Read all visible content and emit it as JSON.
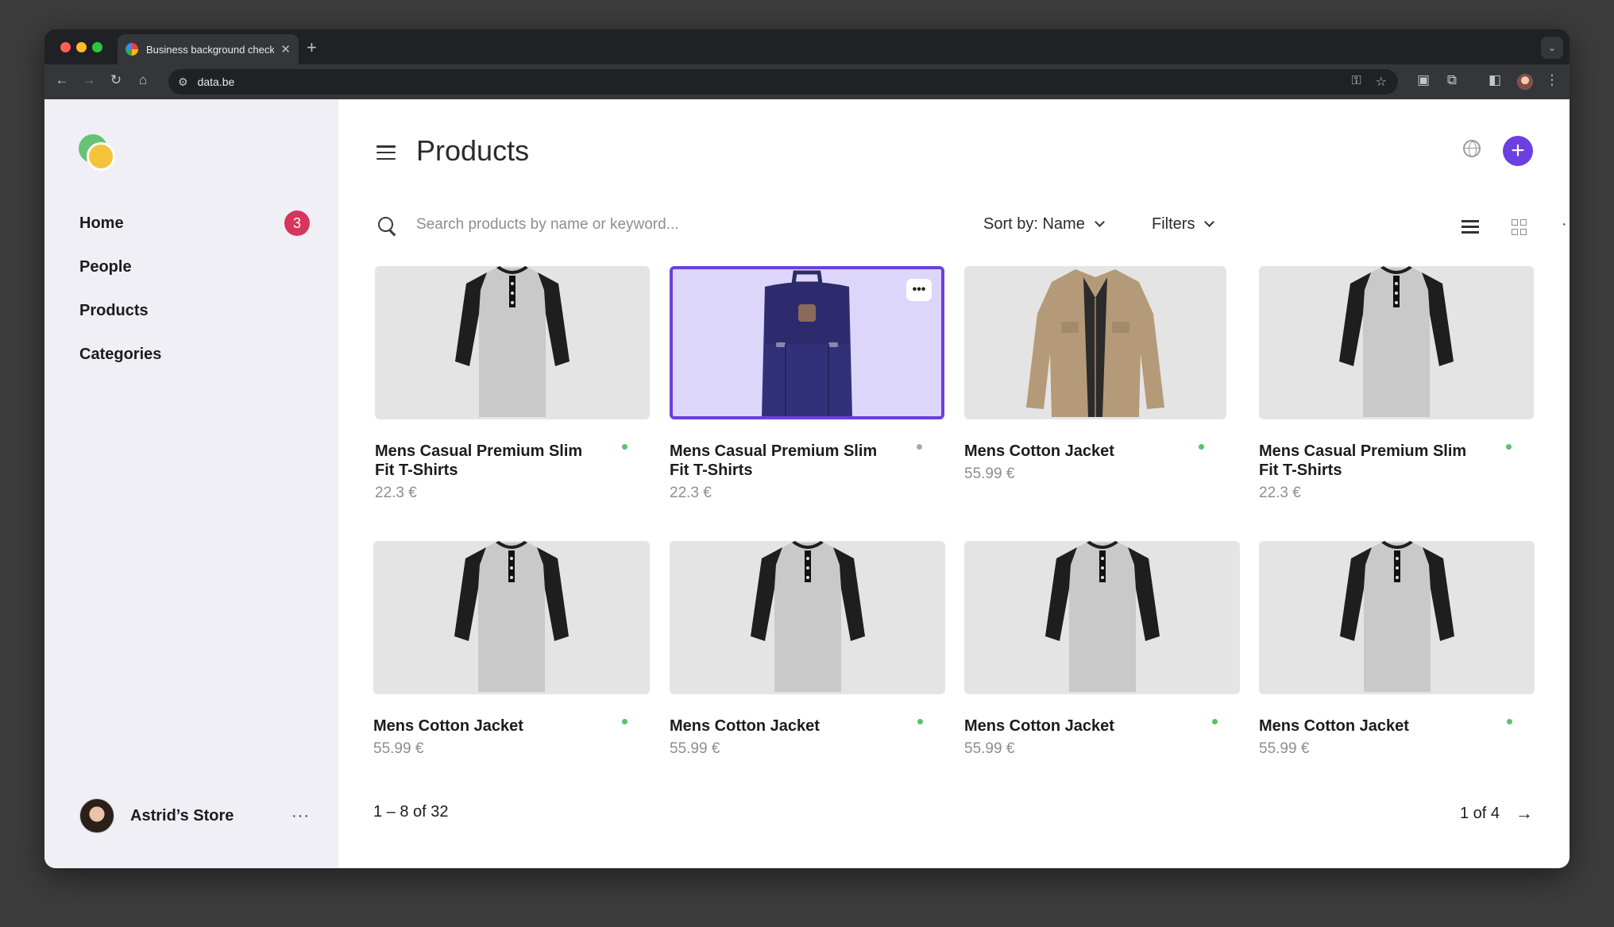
{
  "browser": {
    "tab_title": "Business background checks",
    "tab_close": "✕",
    "new_tab": "+",
    "url": "data.be"
  },
  "sidebar": {
    "items": [
      {
        "label": "Home",
        "badge": "3"
      },
      {
        "label": "People"
      },
      {
        "label": "Products"
      },
      {
        "label": "Categories"
      }
    ],
    "store_name": "Astrid’s Store",
    "store_more": "···"
  },
  "header": {
    "title": "Products",
    "add": "+"
  },
  "toolbar": {
    "search_placeholder": "Search products by name or keyword...",
    "sort_label": "Sort by: Name",
    "filters_label": "Filters",
    "more": "···"
  },
  "products": [
    {
      "name": "Mens Casual Premium Slim Fit T-Shirts",
      "price": "22.3 €",
      "image": "tshirt-icon",
      "status_color": "#5cc16e"
    },
    {
      "name": "Mens Casual Premium Slim Fit T-Shirts",
      "price": "22.3 €",
      "image": "backpack-icon",
      "status_color": "#a9a9a9",
      "selected": true,
      "more": "•••"
    },
    {
      "name": "Mens Cotton Jacket",
      "price": "55.99 €",
      "image": "jacket-icon",
      "status_color": "#5cc16e"
    },
    {
      "name": "Mens Casual Premium Slim Fit T-Shirts",
      "price": "22.3 €",
      "image": "tshirt-icon",
      "status_color": "#5cc16e"
    },
    {
      "name": "Mens Cotton Jacket",
      "price": "55.99 €",
      "image": "tshirt-icon",
      "status_color": "#5cc16e"
    },
    {
      "name": "Mens Cotton Jacket",
      "price": "55.99 €",
      "image": "tshirt-icon",
      "status_color": "#5cc16e"
    },
    {
      "name": "Mens Cotton Jacket",
      "price": "55.99 €",
      "image": "tshirt-icon",
      "status_color": "#5cc16e"
    },
    {
      "name": "Mens Cotton Jacket",
      "price": "55.99 €",
      "image": "tshirt-icon",
      "status_color": "#5cc16e"
    }
  ],
  "pagination": {
    "range": "1 – 8 of 32",
    "page": "1 of 4",
    "next": "→"
  },
  "colors": {
    "accent": "#6b3fe0",
    "badge": "#d5365b",
    "status_active": "#5cc16e",
    "status_inactive": "#a9a9a9"
  }
}
